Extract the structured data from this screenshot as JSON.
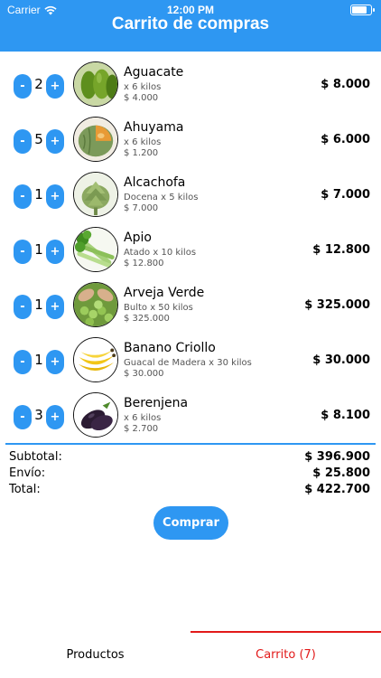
{
  "status_bar": {
    "carrier": "Carrier",
    "time": "12:00 PM",
    "battery_level": 0.85
  },
  "header": {
    "title": "Carrito de compras"
  },
  "colors": {
    "primary": "#2e97f2",
    "active_tab": "#e21a1a",
    "text": "#000000",
    "secondary_text": "#555555"
  },
  "controls": {
    "minus_label": "-",
    "plus_label": "+"
  },
  "items": [
    {
      "quantity": "2",
      "name": "Aguacate",
      "unit": "x 6 kilos",
      "price": "$ 4.000",
      "total": "$ 8.000",
      "image": "avocado-image"
    },
    {
      "quantity": "5",
      "name": "Ahuyama",
      "unit": "x 6 kilos",
      "price": "$ 1.200",
      "total": "$ 6.000",
      "image": "squash-image"
    },
    {
      "quantity": "1",
      "name": "Alcachofa",
      "unit": "Docena x 5 kilos",
      "price": "$ 7.000",
      "total": "$ 7.000",
      "image": "artichoke-image"
    },
    {
      "quantity": "1",
      "name": "Apio",
      "unit": "Atado x 10 kilos",
      "price": "$ 12.800",
      "total": "$ 12.800",
      "image": "celery-image"
    },
    {
      "quantity": "1",
      "name": "Arveja Verde",
      "unit": "Bulto x 50 kilos",
      "price": "$ 325.000",
      "total": "$ 325.000",
      "image": "peas-image"
    },
    {
      "quantity": "1",
      "name": "Banano Criollo",
      "unit": "Guacal de Madera x 30 kilos",
      "price": "$ 30.000",
      "total": "$ 30.000",
      "image": "banana-image"
    },
    {
      "quantity": "3",
      "name": "Berenjena",
      "unit": "x 6 kilos",
      "price": "$ 2.700",
      "total": "$ 8.100",
      "image": "eggplant-image"
    }
  ],
  "summary": {
    "subtotal_label": "Subtotal:",
    "subtotal_value": "$ 396.900",
    "shipping_label": "Envío:",
    "shipping_value": "$ 25.800",
    "total_label": "Total:",
    "total_value": "$ 422.700"
  },
  "buy_button": {
    "label": "Comprar"
  },
  "tabs": [
    {
      "label": "Productos",
      "active": false
    },
    {
      "label": "Carrito (7)",
      "active": true
    }
  ]
}
